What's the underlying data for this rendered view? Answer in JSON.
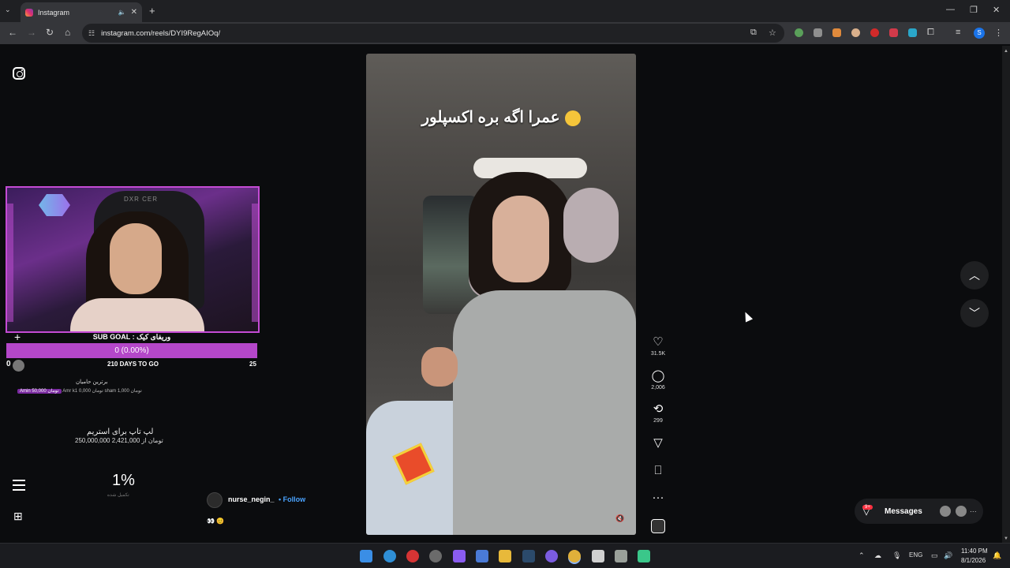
{
  "browser": {
    "tab_title": "Instagram",
    "tab_mute_icon": "speaker-mute-icon",
    "tab_close": "✕",
    "new_tab": "+",
    "url": "instagram.com/reels/DYI9RegAIOq/",
    "window_minimize": "—",
    "window_restore": "❐",
    "window_close": "✕",
    "profile_initial": "S"
  },
  "stream": {
    "sub_goal_title": "SUB GOAL : وریفای کیک",
    "sub_goal_progress": "0 (0.00%)",
    "sub_goal_fraction": 0.0,
    "sub_left": "0",
    "days_to_go": "210 DAYS TO GO",
    "sub_right": "25",
    "donors_title": "برترین حامیان",
    "donors": [
      {
        "text": "Amin 50,000 تومان",
        "top": true
      },
      {
        "text": "Amr k1 تومان 0,000",
        "top": false
      },
      {
        "text": "sham تومان 1,000",
        "top": false
      }
    ],
    "laptop_title": "لپ تاپ برای استریم",
    "laptop_amount": "250,000,000 تومان از 2,421,000",
    "percent": "1%",
    "percent_label": "تکمیل شده"
  },
  "reel": {
    "caption": "عمرا اگه بره اکسپلور",
    "author": "nurse_negin_",
    "follow": "• Follow",
    "emoji_line": "👀 😊",
    "likes": "31.5K",
    "comments": "2,006",
    "reposts": "299"
  },
  "messages": {
    "label": "Messages",
    "badge": "9+"
  },
  "taskbar": {
    "lang": "ENG",
    "time": "11:40 PM",
    "date": "8/1/2026"
  },
  "colors": {
    "accent_purple": "#b447c9",
    "follow_blue": "#4aa3ff",
    "badge_red": "#ff3040"
  }
}
